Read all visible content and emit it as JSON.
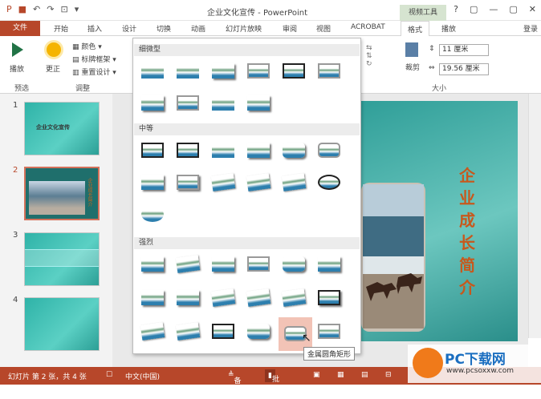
{
  "titlebar": {
    "title": "企业文化宣传 - PowerPoint",
    "context_tab": "视频工具",
    "help": "?",
    "minimize": "—",
    "restore": "▢",
    "close": "✕"
  },
  "tabs": [
    "文件",
    "开始",
    "插入",
    "设计",
    "切换",
    "动画",
    "幻灯片放映",
    "审阅",
    "视图",
    "ACROBAT",
    "格式",
    "播放"
  ],
  "login": "登录",
  "ribbon": {
    "play_label": "播放",
    "preview_group": "预选",
    "correct_label": "更正",
    "color_label": "颜色",
    "poster_label": "标牌框架",
    "reset_label": "重置设计",
    "adjust_group": "调整",
    "crop_label": "裁剪",
    "height_value": "11 厘米",
    "width_value": "19.56 厘米",
    "size_group": "大小"
  },
  "gallery": {
    "sections": [
      "细微型",
      "中等",
      "强烈"
    ],
    "tooltip": "金属圆角矩形"
  },
  "slides": {
    "numbers": [
      "1",
      "2",
      "3",
      "4"
    ],
    "thumb1_title": "企业文化宣传",
    "thumb2_vertical": "企业成长简介"
  },
  "slide_title": "企业成长简介",
  "statusbar": {
    "slide_info": "幻灯片 第 2 张，共 4 张",
    "language": "中文(中国)",
    "notes": "备注",
    "comments": "批注"
  },
  "watermark": {
    "logo": "PC下载网",
    "url": "www.pcsoxxw.com"
  }
}
